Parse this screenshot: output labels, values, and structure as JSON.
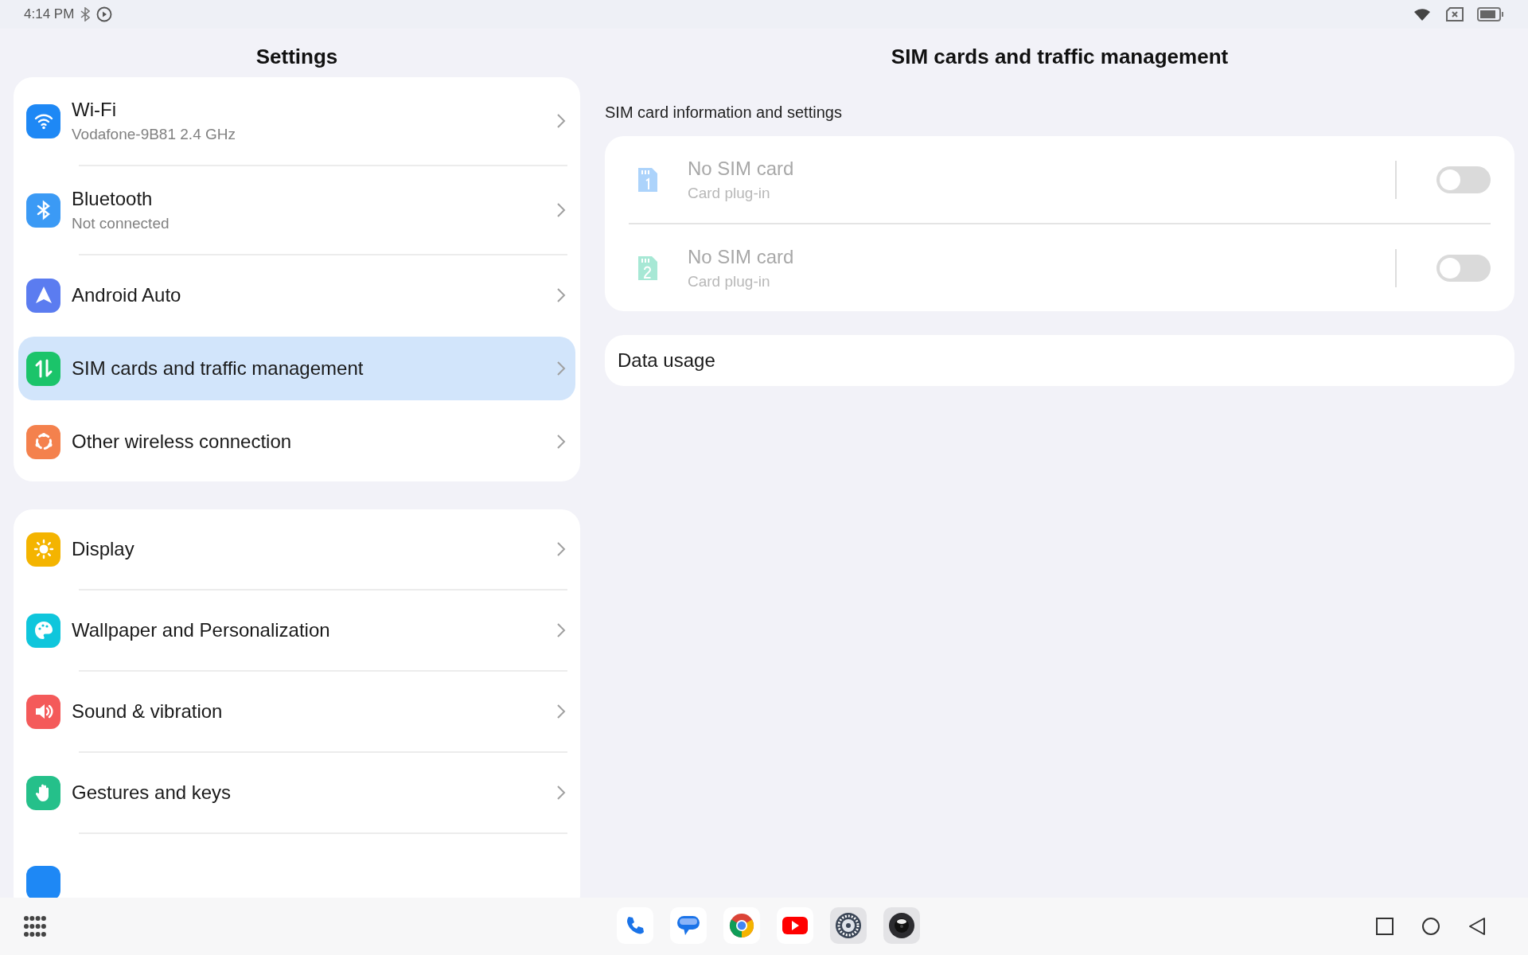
{
  "status_bar": {
    "time": "4:14 PM"
  },
  "settings": {
    "title": "Settings",
    "groups": [
      {
        "items": [
          {
            "label": "Wi-Fi",
            "subtitle": "Vodafone-9B81 2.4 GHz",
            "selected": false
          },
          {
            "label": "Bluetooth",
            "subtitle": "Not connected",
            "selected": false
          },
          {
            "label": "Android Auto",
            "selected": false
          },
          {
            "label": "SIM cards and traffic management",
            "selected": true
          },
          {
            "label": "Other wireless connection",
            "selected": false
          }
        ]
      },
      {
        "items": [
          {
            "label": "Display",
            "selected": false
          },
          {
            "label": "Wallpaper and Personalization",
            "selected": false
          },
          {
            "label": "Sound & vibration",
            "selected": false
          },
          {
            "label": "Gestures and keys",
            "selected": false
          }
        ]
      }
    ]
  },
  "detail": {
    "title": "SIM cards and traffic management",
    "section": "SIM card information and settings",
    "sims": [
      {
        "name": "No SIM card",
        "subtitle": "Card plug-in",
        "disabled": true,
        "on": false
      },
      {
        "name": "No SIM card",
        "subtitle": "Card plug-in",
        "disabled": true,
        "on": false
      }
    ],
    "data_usage": "Data usage"
  }
}
